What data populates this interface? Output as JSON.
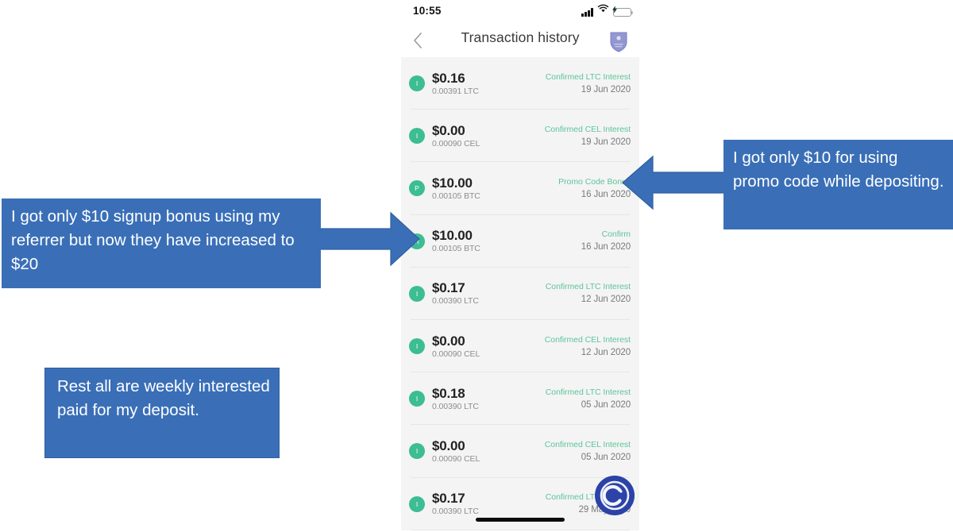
{
  "phone": {
    "status_bar": {
      "time": "10:55",
      "icons": [
        "signal-icon",
        "wifi-icon",
        "battery-charging-icon"
      ]
    },
    "nav": {
      "back_label": "‹",
      "title": "Transaction history",
      "logo_name": "celsius-shield-logo"
    },
    "transactions": [
      {
        "badge": "I",
        "amount": "$0.16",
        "crypto": "0.00391 LTC",
        "type": "Confirmed LTC Interest",
        "date": "19 Jun 2020"
      },
      {
        "badge": "I",
        "amount": "$0.00",
        "crypto": "0.00090 CEL",
        "type": "Confirmed CEL Interest",
        "date": "19 Jun 2020"
      },
      {
        "badge": "P",
        "amount": "$10.00",
        "crypto": "0.00105 BTC",
        "type": "Promo Code Bonus",
        "date": "16 Jun 2020"
      },
      {
        "badge": "R",
        "amount": "$10.00",
        "crypto": "0.00105 BTC",
        "type": "Confirm",
        "date": "16 Jun 2020"
      },
      {
        "badge": "I",
        "amount": "$0.17",
        "crypto": "0.00390 LTC",
        "type": "Confirmed LTC Interest",
        "date": "12 Jun 2020"
      },
      {
        "badge": "I",
        "amount": "$0.00",
        "crypto": "0.00090 CEL",
        "type": "Confirmed CEL Interest",
        "date": "12 Jun 2020"
      },
      {
        "badge": "I",
        "amount": "$0.18",
        "crypto": "0.00390 LTC",
        "type": "Confirmed LTC Interest",
        "date": "05 Jun 2020"
      },
      {
        "badge": "I",
        "amount": "$0.00",
        "crypto": "0.00090 CEL",
        "type": "Confirmed CEL Interest",
        "date": "05 Jun 2020"
      },
      {
        "badge": "I",
        "amount": "$0.17",
        "crypto": "0.00390 LTC",
        "type": "Confirmed LTC Interest",
        "date": "29 May 2020"
      }
    ]
  },
  "annotations": {
    "signup_bonus": "I got only $10 signup bonus using my referrer but now they have increased to $20",
    "promo_code": "I got only $10 for using promo code while depositing.",
    "weekly_interest": "Rest all are weekly interested paid for my deposit."
  },
  "colors": {
    "callout_blue": "#3a6fb7",
    "accent_green": "#3cbd93",
    "type_green": "#5ec49b",
    "list_background": "#f4f4f4",
    "brand_purple": "#8d91cc",
    "watermark_blue": "#2b43a8"
  },
  "watermark": {
    "name": "copyright-watermark",
    "glyph": "©"
  }
}
